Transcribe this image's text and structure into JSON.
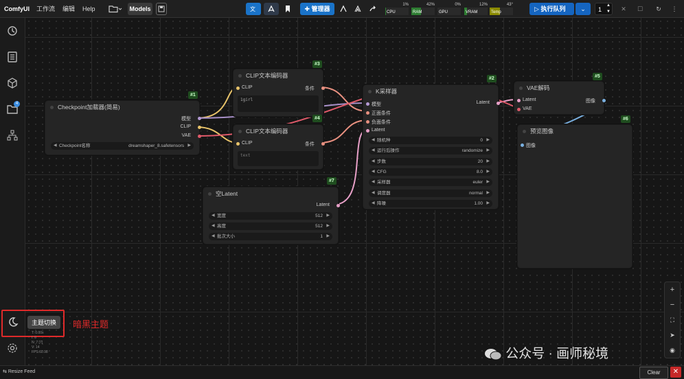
{
  "menu": {
    "app_name": "ComfyUI",
    "workflow": "工作流",
    "edit": "编辑",
    "help": "Help",
    "models": "Models"
  },
  "toolbar": {
    "manager": "管理器",
    "queue_button": "执行队列",
    "queue_count": "1"
  },
  "meters": [
    {
      "label": "CPU",
      "pct": "1%",
      "value": 0.01,
      "color": "#2e7d32"
    },
    {
      "label": "RAM",
      "pct": "42%",
      "value": 0.42,
      "color": "#2e7d32"
    },
    {
      "label": "GPU",
      "pct": "0%",
      "value": 0.0,
      "color": "#2e7d32"
    },
    {
      "label": "VRAM",
      "pct": "12%",
      "value": 0.12,
      "color": "#2e7d32"
    },
    {
      "label": "Temp",
      "pct": "43°",
      "value": 0.43,
      "color": "#8a8a00"
    }
  ],
  "sidebar": {
    "badge": "4",
    "tooltip": "主题切换"
  },
  "annotation": "暗黑主题",
  "stats": {
    "t": "T: 0.00s",
    "i": "I: 0",
    "n": "N: 7 [7]",
    "v": "V: 14",
    "fps": "FPS:60.98"
  },
  "nodes": {
    "checkpoint": {
      "id": "#1",
      "title": "Checkpoint加载器(简易)",
      "out_model": "模型",
      "out_clip": "CLIP",
      "out_vae": "VAE",
      "w_label": "Checkpoint名称",
      "w_value": "dreamshaper_8.safetensors"
    },
    "clip1": {
      "id": "#3",
      "title": "CLIP文本编码器",
      "in_clip": "CLIP",
      "out": "条件",
      "text": "1girl"
    },
    "clip2": {
      "id": "#4",
      "title": "CLIP文本编码器",
      "in_clip": "CLIP",
      "out": "条件",
      "text": "text"
    },
    "latent": {
      "id": "#7",
      "title": "空Latent",
      "out": "Latent",
      "widgets": [
        {
          "label": "宽度",
          "value": "512"
        },
        {
          "label": "高度",
          "value": "512"
        },
        {
          "label": "批次大小",
          "value": "1"
        }
      ]
    },
    "ksampler": {
      "id": "#2",
      "title": "K采样器",
      "inputs": [
        "模型",
        "正面条件",
        "负面条件",
        "Latent"
      ],
      "out": "Latent",
      "widgets": [
        {
          "label": "随机种",
          "value": "0"
        },
        {
          "label": "运行后操作",
          "value": "randomize"
        },
        {
          "label": "步数",
          "value": "20"
        },
        {
          "label": "CFG",
          "value": "8.0"
        },
        {
          "label": "采样器",
          "value": "euler"
        },
        {
          "label": "调度器",
          "value": "normal"
        },
        {
          "label": "降噪",
          "value": "1.00"
        }
      ]
    },
    "vae": {
      "id": "#5",
      "title": "VAE解码",
      "in_latent": "Latent",
      "in_vae": "VAE",
      "out": "图像"
    },
    "preview": {
      "id": "#6",
      "title": "预览图像",
      "in_image": "图像"
    }
  },
  "bottom": {
    "resize": "Resize Feed",
    "clear": "Clear"
  },
  "watermark": "公众号 · 画师秘境"
}
